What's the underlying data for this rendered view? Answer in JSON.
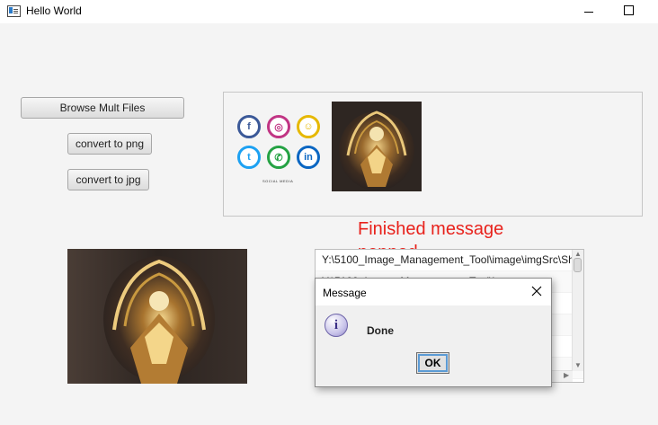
{
  "window": {
    "title": "Hello World"
  },
  "controls": {
    "browse_label": "Browse Mult Files",
    "png_label": "convert to png",
    "jpg_label": "convert to jpg"
  },
  "preview": {
    "social_icons": [
      "facebook-icon",
      "instagram-icon",
      "snapchat-icon",
      "twitter-icon",
      "whatsapp-icon",
      "linkedin-icon"
    ],
    "social_glyphs": [
      "f",
      "◎",
      "☺",
      "t",
      "✆",
      "in"
    ],
    "social_colors": [
      "#3b5998",
      "#c13584",
      "#e6b800",
      "#1da1f2",
      "#25a244",
      "#0a66c2"
    ],
    "caption": "SOCIAL MEDIA"
  },
  "annotation": {
    "text": "Finished message popped"
  },
  "file_list": {
    "rows": [
      "Y:\\5100_Image_Management_Tool\\image\\imgSrc\\Sh",
      "Y:\\5100_Image_Management_Tool\\i",
      "",
      "",
      "",
      ""
    ]
  },
  "dialog": {
    "title": "Message",
    "message": "Done",
    "ok_label": "OK"
  },
  "colors": {
    "annotation": "#e8221c",
    "focus_ring": "#5b9bd5"
  }
}
